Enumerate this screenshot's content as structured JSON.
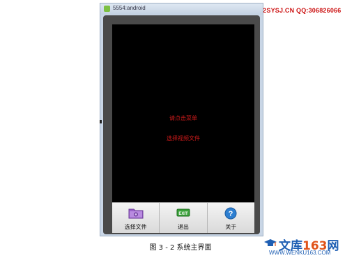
{
  "watermark_top": "HTTP://WWW.2SYSJ.CN QQ:306826066",
  "window": {
    "title": "5554:android"
  },
  "screen": {
    "messages": [
      "请点击菜单",
      "选择视频文件"
    ]
  },
  "menu": {
    "items": [
      {
        "label": "选择文件",
        "icon": "folder-icon"
      },
      {
        "label": "退出",
        "icon": "exit-icon"
      },
      {
        "label": "关于",
        "icon": "help-icon"
      }
    ]
  },
  "caption": "图 3 - 2  系统主界面",
  "watermark_logo": {
    "main_text": "文库",
    "number": "163",
    "suffix": "网",
    "sub_text": "WWW.WENKU163.COM"
  }
}
